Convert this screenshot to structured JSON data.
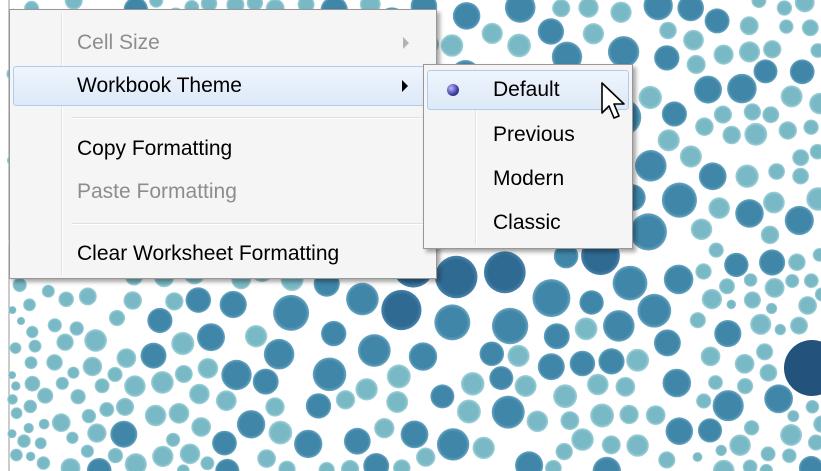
{
  "menu": {
    "items": [
      {
        "label": "Cell Size",
        "enabled": false,
        "submenu": true
      },
      {
        "label": "Workbook Theme",
        "enabled": true,
        "submenu": true,
        "highlighted": true
      },
      {
        "label": "Copy Formatting",
        "enabled": true
      },
      {
        "label": "Paste Formatting",
        "enabled": false
      },
      {
        "label": "Clear Worksheet Formatting",
        "enabled": true
      }
    ]
  },
  "submenu": {
    "items": [
      {
        "label": "Default",
        "selected": true
      },
      {
        "label": "Previous"
      },
      {
        "label": "Modern"
      },
      {
        "label": "Classic"
      }
    ]
  },
  "colors": {
    "menu_bg": "#f5f5f5",
    "highlight_border": "#aecbf0",
    "bubble_dark": "#2e5f87",
    "bubble_light": "#8fc7cf"
  },
  "icons": [
    "submenu-arrow-icon",
    "radio-selected-icon",
    "mouse-cursor-icon"
  ]
}
